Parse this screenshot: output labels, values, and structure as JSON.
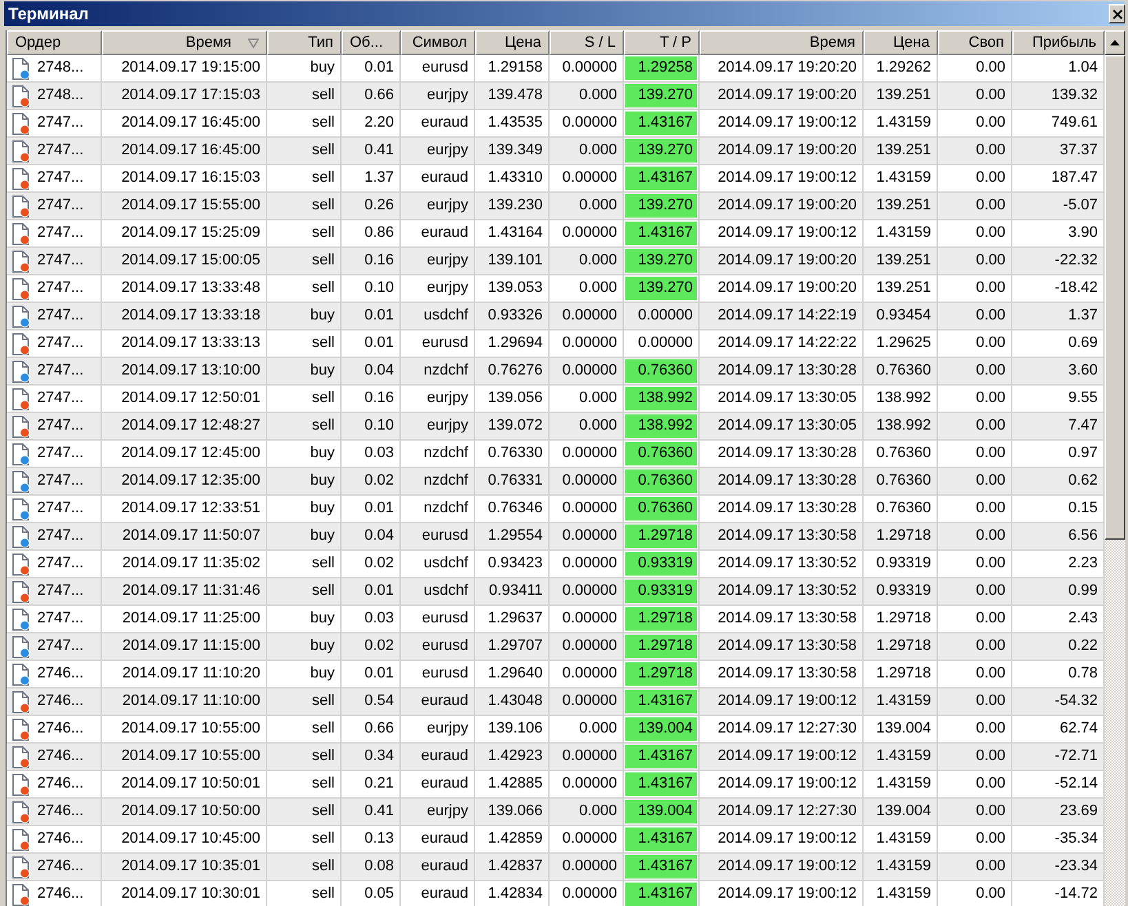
{
  "window": {
    "title": "Терминал"
  },
  "table": {
    "columns": [
      {
        "label": "Ордер",
        "sorted": false
      },
      {
        "label": "Время",
        "sorted": true
      },
      {
        "label": "Тип",
        "sorted": false
      },
      {
        "label": "Об...",
        "sorted": false
      },
      {
        "label": "Символ",
        "sorted": false
      },
      {
        "label": "Цена",
        "sorted": false
      },
      {
        "label": "S / L",
        "sorted": false
      },
      {
        "label": "T / P",
        "sorted": false
      },
      {
        "label": "Время",
        "sorted": false
      },
      {
        "label": "Цена",
        "sorted": false
      },
      {
        "label": "Своп",
        "sorted": false
      },
      {
        "label": "Прибыль",
        "sorted": false
      }
    ],
    "rows": [
      {
        "kind": "buy",
        "tp_highlighted": true,
        "cells": [
          "2748...",
          "2014.09.17 19:15:00",
          "buy",
          "0.01",
          "eurusd",
          "1.29158",
          "0.00000",
          "1.29258",
          "2014.09.17 19:20:20",
          "1.29262",
          "0.00",
          "1.04"
        ]
      },
      {
        "kind": "sell",
        "tp_highlighted": true,
        "cells": [
          "2748...",
          "2014.09.17 17:15:03",
          "sell",
          "0.66",
          "eurjpy",
          "139.478",
          "0.000",
          "139.270",
          "2014.09.17 19:00:20",
          "139.251",
          "0.00",
          "139.32"
        ]
      },
      {
        "kind": "sell",
        "tp_highlighted": true,
        "cells": [
          "2747...",
          "2014.09.17 16:45:00",
          "sell",
          "2.20",
          "euraud",
          "1.43535",
          "0.00000",
          "1.43167",
          "2014.09.17 19:00:12",
          "1.43159",
          "0.00",
          "749.61"
        ]
      },
      {
        "kind": "sell",
        "tp_highlighted": true,
        "cells": [
          "2747...",
          "2014.09.17 16:45:00",
          "sell",
          "0.41",
          "eurjpy",
          "139.349",
          "0.000",
          "139.270",
          "2014.09.17 19:00:20",
          "139.251",
          "0.00",
          "37.37"
        ]
      },
      {
        "kind": "sell",
        "tp_highlighted": true,
        "cells": [
          "2747...",
          "2014.09.17 16:15:03",
          "sell",
          "1.37",
          "euraud",
          "1.43310",
          "0.00000",
          "1.43167",
          "2014.09.17 19:00:12",
          "1.43159",
          "0.00",
          "187.47"
        ]
      },
      {
        "kind": "sell",
        "tp_highlighted": true,
        "cells": [
          "2747...",
          "2014.09.17 15:55:00",
          "sell",
          "0.26",
          "eurjpy",
          "139.230",
          "0.000",
          "139.270",
          "2014.09.17 19:00:20",
          "139.251",
          "0.00",
          "-5.07"
        ]
      },
      {
        "kind": "sell",
        "tp_highlighted": true,
        "cells": [
          "2747...",
          "2014.09.17 15:25:09",
          "sell",
          "0.86",
          "euraud",
          "1.43164",
          "0.00000",
          "1.43167",
          "2014.09.17 19:00:12",
          "1.43159",
          "0.00",
          "3.90"
        ]
      },
      {
        "kind": "sell",
        "tp_highlighted": true,
        "cells": [
          "2747...",
          "2014.09.17 15:00:05",
          "sell",
          "0.16",
          "eurjpy",
          "139.101",
          "0.000",
          "139.270",
          "2014.09.17 19:00:20",
          "139.251",
          "0.00",
          "-22.32"
        ]
      },
      {
        "kind": "sell",
        "tp_highlighted": true,
        "cells": [
          "2747...",
          "2014.09.17 13:33:48",
          "sell",
          "0.10",
          "eurjpy",
          "139.053",
          "0.000",
          "139.270",
          "2014.09.17 19:00:20",
          "139.251",
          "0.00",
          "-18.42"
        ]
      },
      {
        "kind": "buy",
        "tp_highlighted": false,
        "cells": [
          "2747...",
          "2014.09.17 13:33:18",
          "buy",
          "0.01",
          "usdchf",
          "0.93326",
          "0.00000",
          "0.00000",
          "2014.09.17 14:22:19",
          "0.93454",
          "0.00",
          "1.37"
        ]
      },
      {
        "kind": "sell",
        "tp_highlighted": false,
        "cells": [
          "2747...",
          "2014.09.17 13:33:13",
          "sell",
          "0.01",
          "eurusd",
          "1.29694",
          "0.00000",
          "0.00000",
          "2014.09.17 14:22:22",
          "1.29625",
          "0.00",
          "0.69"
        ]
      },
      {
        "kind": "buy",
        "tp_highlighted": true,
        "cells": [
          "2747...",
          "2014.09.17 13:10:00",
          "buy",
          "0.04",
          "nzdchf",
          "0.76276",
          "0.00000",
          "0.76360",
          "2014.09.17 13:30:28",
          "0.76360",
          "0.00",
          "3.60"
        ]
      },
      {
        "kind": "sell",
        "tp_highlighted": true,
        "cells": [
          "2747...",
          "2014.09.17 12:50:01",
          "sell",
          "0.16",
          "eurjpy",
          "139.056",
          "0.000",
          "138.992",
          "2014.09.17 13:30:05",
          "138.992",
          "0.00",
          "9.55"
        ]
      },
      {
        "kind": "sell",
        "tp_highlighted": true,
        "cells": [
          "2747...",
          "2014.09.17 12:48:27",
          "sell",
          "0.10",
          "eurjpy",
          "139.072",
          "0.000",
          "138.992",
          "2014.09.17 13:30:05",
          "138.992",
          "0.00",
          "7.47"
        ]
      },
      {
        "kind": "buy",
        "tp_highlighted": true,
        "cells": [
          "2747...",
          "2014.09.17 12:45:00",
          "buy",
          "0.03",
          "nzdchf",
          "0.76330",
          "0.00000",
          "0.76360",
          "2014.09.17 13:30:28",
          "0.76360",
          "0.00",
          "0.97"
        ]
      },
      {
        "kind": "buy",
        "tp_highlighted": true,
        "cells": [
          "2747...",
          "2014.09.17 12:35:00",
          "buy",
          "0.02",
          "nzdchf",
          "0.76331",
          "0.00000",
          "0.76360",
          "2014.09.17 13:30:28",
          "0.76360",
          "0.00",
          "0.62"
        ]
      },
      {
        "kind": "buy",
        "tp_highlighted": true,
        "cells": [
          "2747...",
          "2014.09.17 12:33:51",
          "buy",
          "0.01",
          "nzdchf",
          "0.76346",
          "0.00000",
          "0.76360",
          "2014.09.17 13:30:28",
          "0.76360",
          "0.00",
          "0.15"
        ]
      },
      {
        "kind": "buy",
        "tp_highlighted": true,
        "cells": [
          "2747...",
          "2014.09.17 11:50:07",
          "buy",
          "0.04",
          "eurusd",
          "1.29554",
          "0.00000",
          "1.29718",
          "2014.09.17 13:30:58",
          "1.29718",
          "0.00",
          "6.56"
        ]
      },
      {
        "kind": "sell",
        "tp_highlighted": true,
        "cells": [
          "2747...",
          "2014.09.17 11:35:02",
          "sell",
          "0.02",
          "usdchf",
          "0.93423",
          "0.00000",
          "0.93319",
          "2014.09.17 13:30:52",
          "0.93319",
          "0.00",
          "2.23"
        ]
      },
      {
        "kind": "sell",
        "tp_highlighted": true,
        "cells": [
          "2747...",
          "2014.09.17 11:31:46",
          "sell",
          "0.01",
          "usdchf",
          "0.93411",
          "0.00000",
          "0.93319",
          "2014.09.17 13:30:52",
          "0.93319",
          "0.00",
          "0.99"
        ]
      },
      {
        "kind": "buy",
        "tp_highlighted": true,
        "cells": [
          "2747...",
          "2014.09.17 11:25:00",
          "buy",
          "0.03",
          "eurusd",
          "1.29637",
          "0.00000",
          "1.29718",
          "2014.09.17 13:30:58",
          "1.29718",
          "0.00",
          "2.43"
        ]
      },
      {
        "kind": "buy",
        "tp_highlighted": true,
        "cells": [
          "2747...",
          "2014.09.17 11:15:00",
          "buy",
          "0.02",
          "eurusd",
          "1.29707",
          "0.00000",
          "1.29718",
          "2014.09.17 13:30:58",
          "1.29718",
          "0.00",
          "0.22"
        ]
      },
      {
        "kind": "buy",
        "tp_highlighted": true,
        "cells": [
          "2746...",
          "2014.09.17 11:10:20",
          "buy",
          "0.01",
          "eurusd",
          "1.29640",
          "0.00000",
          "1.29718",
          "2014.09.17 13:30:58",
          "1.29718",
          "0.00",
          "0.78"
        ]
      },
      {
        "kind": "sell",
        "tp_highlighted": true,
        "cells": [
          "2746...",
          "2014.09.17 11:10:00",
          "sell",
          "0.54",
          "euraud",
          "1.43048",
          "0.00000",
          "1.43167",
          "2014.09.17 19:00:12",
          "1.43159",
          "0.00",
          "-54.32"
        ]
      },
      {
        "kind": "sell",
        "tp_highlighted": true,
        "cells": [
          "2746...",
          "2014.09.17 10:55:00",
          "sell",
          "0.66",
          "eurjpy",
          "139.106",
          "0.000",
          "139.004",
          "2014.09.17 12:27:30",
          "139.004",
          "0.00",
          "62.74"
        ]
      },
      {
        "kind": "sell",
        "tp_highlighted": true,
        "cells": [
          "2746...",
          "2014.09.17 10:55:00",
          "sell",
          "0.34",
          "euraud",
          "1.42923",
          "0.00000",
          "1.43167",
          "2014.09.17 19:00:12",
          "1.43159",
          "0.00",
          "-72.71"
        ]
      },
      {
        "kind": "sell",
        "tp_highlighted": true,
        "cells": [
          "2746...",
          "2014.09.17 10:50:01",
          "sell",
          "0.21",
          "euraud",
          "1.42885",
          "0.00000",
          "1.43167",
          "2014.09.17 19:00:12",
          "1.43159",
          "0.00",
          "-52.14"
        ]
      },
      {
        "kind": "sell",
        "tp_highlighted": true,
        "cells": [
          "2746...",
          "2014.09.17 10:50:00",
          "sell",
          "0.41",
          "eurjpy",
          "139.066",
          "0.000",
          "139.004",
          "2014.09.17 12:27:30",
          "139.004",
          "0.00",
          "23.69"
        ]
      },
      {
        "kind": "sell",
        "tp_highlighted": true,
        "cells": [
          "2746...",
          "2014.09.17 10:45:00",
          "sell",
          "0.13",
          "euraud",
          "1.42859",
          "0.00000",
          "1.43167",
          "2014.09.17 19:00:12",
          "1.43159",
          "0.00",
          "-35.34"
        ]
      },
      {
        "kind": "sell",
        "tp_highlighted": true,
        "cells": [
          "2746...",
          "2014.09.17 10:35:01",
          "sell",
          "0.08",
          "euraud",
          "1.42837",
          "0.00000",
          "1.43167",
          "2014.09.17 19:00:12",
          "1.43159",
          "0.00",
          "-23.34"
        ]
      },
      {
        "kind": "sell",
        "tp_highlighted": true,
        "cells": [
          "2746...",
          "2014.09.17 10:30:01",
          "sell",
          "0.05",
          "euraud",
          "1.42834",
          "0.00000",
          "1.43167",
          "2014.09.17 19:00:12",
          "1.43159",
          "0.00",
          "-14.72"
        ]
      }
    ]
  }
}
